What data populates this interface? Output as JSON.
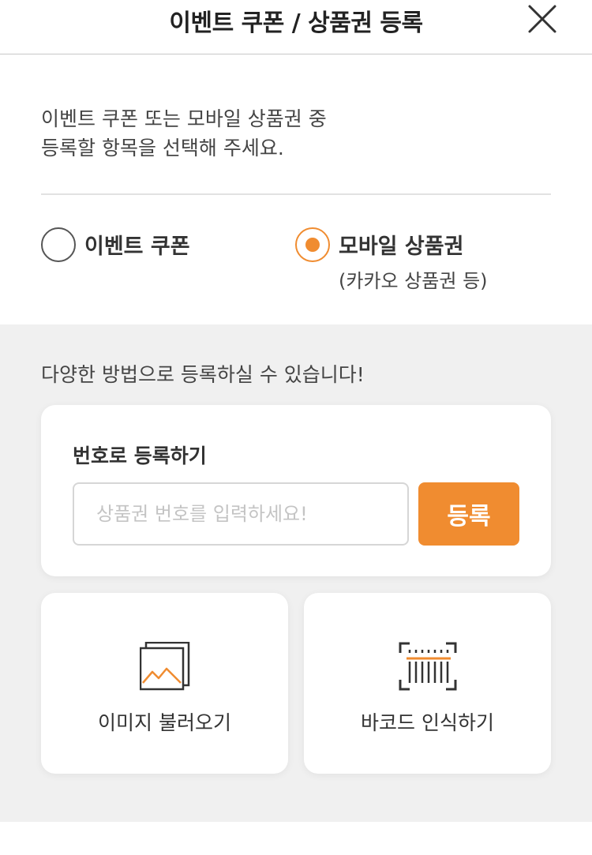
{
  "header": {
    "title": "이벤트 쿠폰 / 상품권 등록",
    "close_icon": "close-icon"
  },
  "intro": {
    "line1": "이벤트 쿠폰 또는 모바일 상품권 중",
    "line2": "등록할 항목을 선택해 주세요."
  },
  "options": [
    {
      "label": "이벤트 쿠폰",
      "sublabel": "",
      "selected": false
    },
    {
      "label": "모바일 상품권",
      "sublabel": "(카카오 상품권 등)",
      "selected": true
    }
  ],
  "methods": {
    "hint": "다양한 방법으로 등록하실 수 있습니다!",
    "by_number": {
      "title": "번호로 등록하기",
      "placeholder": "상품권 번호를 입력하세요!",
      "value": "",
      "button_label": "등록"
    },
    "image_tile": {
      "label": "이미지 불러오기",
      "icon": "image-gallery-icon"
    },
    "barcode_tile": {
      "label": "바코드 인식하기",
      "icon": "barcode-scan-icon"
    }
  },
  "colors": {
    "accent": "#f08c30",
    "background_gray": "#f0f0f0",
    "text": "#333333"
  }
}
